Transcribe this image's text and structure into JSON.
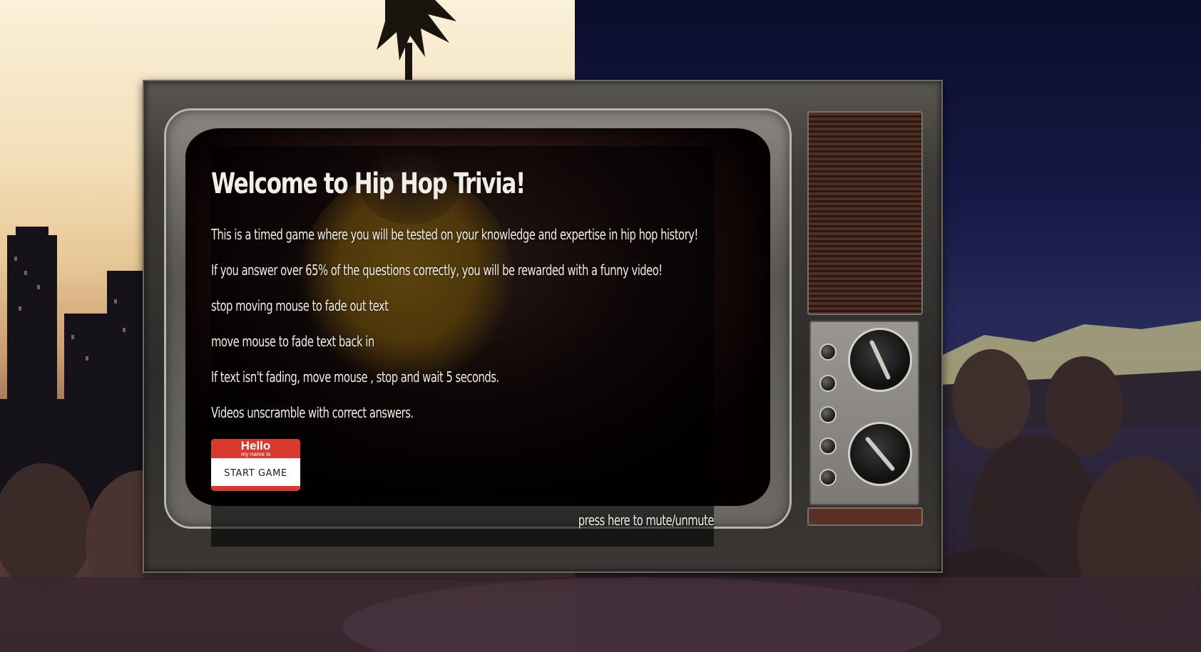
{
  "game": {
    "title": "Welcome to Hip Hop Trivia!",
    "instructions": [
      "This is a timed game where you will be tested on your knowledge and expertise in hip hop history!",
      "If you answer over 65% of the questions correctly, you will be rewarded with a funny video!",
      "stop moving mouse to fade out text",
      "move mouse to fade text back in",
      "If text isn't fading, move mouse , stop and wait 5 seconds.",
      "Videos unscramble with correct answers."
    ],
    "start_button": {
      "hello": "Hello",
      "my_name_is": "my name is",
      "label": "START GAME"
    },
    "mute_label": "press here to mute/unmute"
  },
  "colors": {
    "name_tag_red": "#d83a2e",
    "text": "#f2ede6",
    "overlay": "rgba(0,0,0,0.58)"
  }
}
